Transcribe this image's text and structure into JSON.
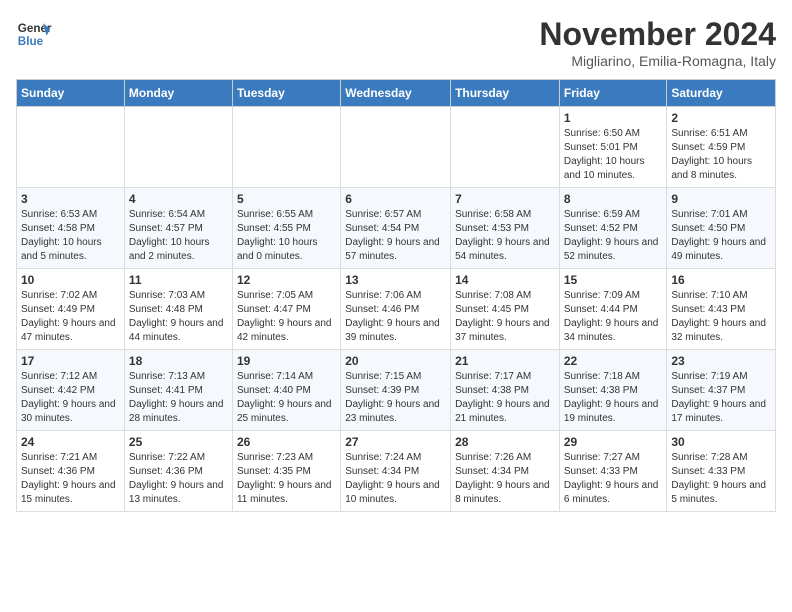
{
  "logo": {
    "line1": "General",
    "line2": "Blue"
  },
  "title": "November 2024",
  "subtitle": "Migliarino, Emilia-Romagna, Italy",
  "headers": [
    "Sunday",
    "Monday",
    "Tuesday",
    "Wednesday",
    "Thursday",
    "Friday",
    "Saturday"
  ],
  "weeks": [
    [
      {
        "day": "",
        "info": ""
      },
      {
        "day": "",
        "info": ""
      },
      {
        "day": "",
        "info": ""
      },
      {
        "day": "",
        "info": ""
      },
      {
        "day": "",
        "info": ""
      },
      {
        "day": "1",
        "info": "Sunrise: 6:50 AM\nSunset: 5:01 PM\nDaylight: 10 hours and 10 minutes."
      },
      {
        "day": "2",
        "info": "Sunrise: 6:51 AM\nSunset: 4:59 PM\nDaylight: 10 hours and 8 minutes."
      }
    ],
    [
      {
        "day": "3",
        "info": "Sunrise: 6:53 AM\nSunset: 4:58 PM\nDaylight: 10 hours and 5 minutes."
      },
      {
        "day": "4",
        "info": "Sunrise: 6:54 AM\nSunset: 4:57 PM\nDaylight: 10 hours and 2 minutes."
      },
      {
        "day": "5",
        "info": "Sunrise: 6:55 AM\nSunset: 4:55 PM\nDaylight: 10 hours and 0 minutes."
      },
      {
        "day": "6",
        "info": "Sunrise: 6:57 AM\nSunset: 4:54 PM\nDaylight: 9 hours and 57 minutes."
      },
      {
        "day": "7",
        "info": "Sunrise: 6:58 AM\nSunset: 4:53 PM\nDaylight: 9 hours and 54 minutes."
      },
      {
        "day": "8",
        "info": "Sunrise: 6:59 AM\nSunset: 4:52 PM\nDaylight: 9 hours and 52 minutes."
      },
      {
        "day": "9",
        "info": "Sunrise: 7:01 AM\nSunset: 4:50 PM\nDaylight: 9 hours and 49 minutes."
      }
    ],
    [
      {
        "day": "10",
        "info": "Sunrise: 7:02 AM\nSunset: 4:49 PM\nDaylight: 9 hours and 47 minutes."
      },
      {
        "day": "11",
        "info": "Sunrise: 7:03 AM\nSunset: 4:48 PM\nDaylight: 9 hours and 44 minutes."
      },
      {
        "day": "12",
        "info": "Sunrise: 7:05 AM\nSunset: 4:47 PM\nDaylight: 9 hours and 42 minutes."
      },
      {
        "day": "13",
        "info": "Sunrise: 7:06 AM\nSunset: 4:46 PM\nDaylight: 9 hours and 39 minutes."
      },
      {
        "day": "14",
        "info": "Sunrise: 7:08 AM\nSunset: 4:45 PM\nDaylight: 9 hours and 37 minutes."
      },
      {
        "day": "15",
        "info": "Sunrise: 7:09 AM\nSunset: 4:44 PM\nDaylight: 9 hours and 34 minutes."
      },
      {
        "day": "16",
        "info": "Sunrise: 7:10 AM\nSunset: 4:43 PM\nDaylight: 9 hours and 32 minutes."
      }
    ],
    [
      {
        "day": "17",
        "info": "Sunrise: 7:12 AM\nSunset: 4:42 PM\nDaylight: 9 hours and 30 minutes."
      },
      {
        "day": "18",
        "info": "Sunrise: 7:13 AM\nSunset: 4:41 PM\nDaylight: 9 hours and 28 minutes."
      },
      {
        "day": "19",
        "info": "Sunrise: 7:14 AM\nSunset: 4:40 PM\nDaylight: 9 hours and 25 minutes."
      },
      {
        "day": "20",
        "info": "Sunrise: 7:15 AM\nSunset: 4:39 PM\nDaylight: 9 hours and 23 minutes."
      },
      {
        "day": "21",
        "info": "Sunrise: 7:17 AM\nSunset: 4:38 PM\nDaylight: 9 hours and 21 minutes."
      },
      {
        "day": "22",
        "info": "Sunrise: 7:18 AM\nSunset: 4:38 PM\nDaylight: 9 hours and 19 minutes."
      },
      {
        "day": "23",
        "info": "Sunrise: 7:19 AM\nSunset: 4:37 PM\nDaylight: 9 hours and 17 minutes."
      }
    ],
    [
      {
        "day": "24",
        "info": "Sunrise: 7:21 AM\nSunset: 4:36 PM\nDaylight: 9 hours and 15 minutes."
      },
      {
        "day": "25",
        "info": "Sunrise: 7:22 AM\nSunset: 4:36 PM\nDaylight: 9 hours and 13 minutes."
      },
      {
        "day": "26",
        "info": "Sunrise: 7:23 AM\nSunset: 4:35 PM\nDaylight: 9 hours and 11 minutes."
      },
      {
        "day": "27",
        "info": "Sunrise: 7:24 AM\nSunset: 4:34 PM\nDaylight: 9 hours and 10 minutes."
      },
      {
        "day": "28",
        "info": "Sunrise: 7:26 AM\nSunset: 4:34 PM\nDaylight: 9 hours and 8 minutes."
      },
      {
        "day": "29",
        "info": "Sunrise: 7:27 AM\nSunset: 4:33 PM\nDaylight: 9 hours and 6 minutes."
      },
      {
        "day": "30",
        "info": "Sunrise: 7:28 AM\nSunset: 4:33 PM\nDaylight: 9 hours and 5 minutes."
      }
    ]
  ]
}
